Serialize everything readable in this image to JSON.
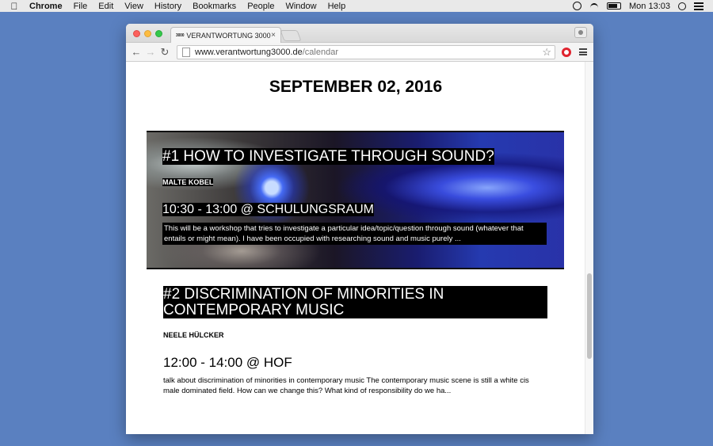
{
  "menubar": {
    "apple": "",
    "items": [
      "Chrome",
      "File",
      "Edit",
      "View",
      "History",
      "Bookmarks",
      "People",
      "Window",
      "Help"
    ],
    "clock": "Mon 13:03"
  },
  "browser": {
    "tab": {
      "favicon_text": "3000",
      "title": "VERANTWORTUNG 3000",
      "close": "×"
    },
    "nav": {
      "back": "←",
      "forward": "→",
      "reload": "↻"
    },
    "address": {
      "host": "www.verantwortung3000.de",
      "path": "/calendar"
    },
    "star": "☆"
  },
  "page": {
    "date_heading": "SEPTEMBER 02, 2016",
    "events": [
      {
        "title": "#1 HOW TO INVESTIGATE THROUGH SOUND?",
        "person": "MALTE KOBEL",
        "time": "10:30 - 13:00 @ SCHULUNGSRAUM",
        "description": "This will be a workshop that tries to investigate a particular idea/topic/question through sound (whatever that entails or might mean). I have been occupied with researching sound and music purely ..."
      },
      {
        "title": "#2 DISCRIMINATION OF MINORITIES IN CONTEMPORARY MUSIC",
        "person": "NEELE HÜLCKER",
        "time": "12:00 - 14:00 @ HOF",
        "description": "talk about discrimination of minorities in contemporary music The contemporary music scene is still a white cis male dominated field. How can we change this? What kind of responsibility do we ha..."
      }
    ]
  }
}
